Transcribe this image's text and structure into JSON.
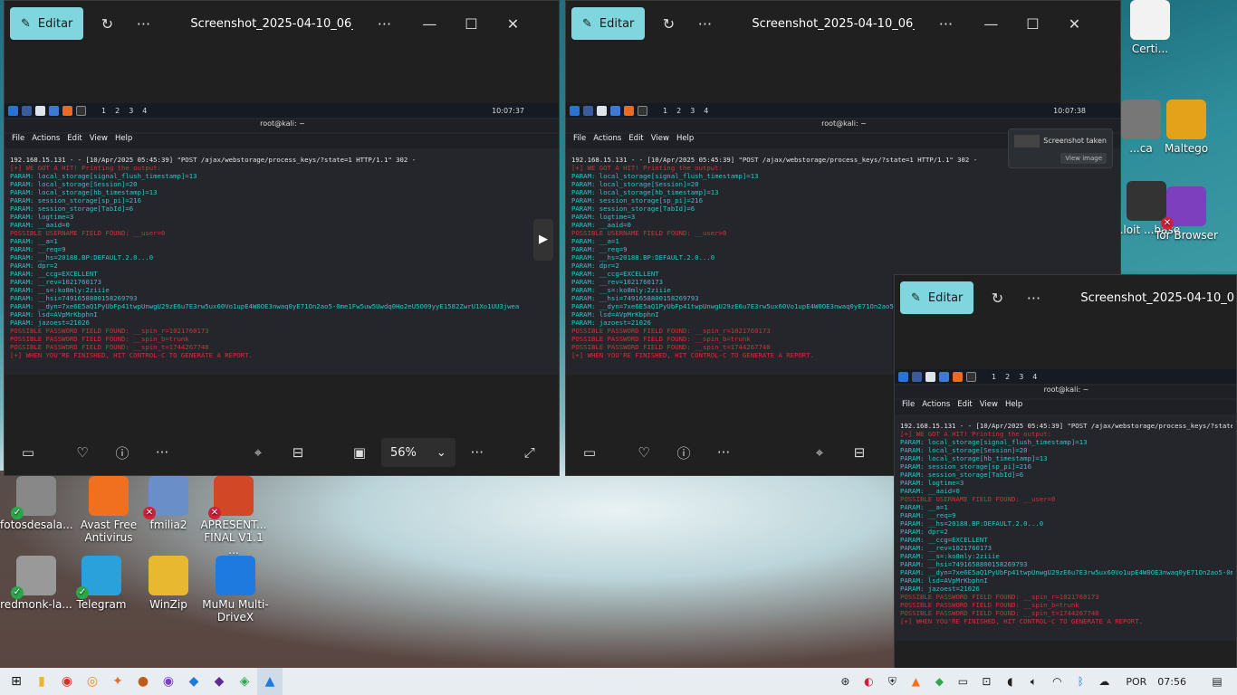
{
  "desktop": {
    "icons": [
      {
        "label": "fotosdesala...",
        "color": "#888",
        "badge": "ok"
      },
      {
        "label": "Avast Free Antivirus",
        "color": "#f07020",
        "badge": ""
      },
      {
        "label": "fmilia2",
        "color": "#6a8ec8",
        "badge": "err"
      },
      {
        "label": "APRESENT... FINAL V1.1 ...",
        "color": "#d24726",
        "badge": "err"
      },
      {
        "label": "redmonk-la...",
        "color": "#999",
        "badge": "ok"
      },
      {
        "label": "Telegram",
        "color": "#2aa1da",
        "badge": "ok"
      },
      {
        "label": "WinZip",
        "color": "#e8b830",
        "badge": ""
      },
      {
        "label": "MuMu Multi-DriveX",
        "color": "#1f7ae0",
        "badge": ""
      },
      {
        "label": "Certi...",
        "color": "#f2f2f2",
        "badge": ""
      },
      {
        "label": "...ca",
        "color": "#777",
        "badge": ""
      },
      {
        "label": "Maltego",
        "color": "#e3a21a",
        "badge": ""
      },
      {
        "label": "...loit ...base",
        "color": "#333",
        "badge": ""
      },
      {
        "label": "Tor Browser",
        "color": "#7e3fbf",
        "badge": "err"
      }
    ]
  },
  "viewer": {
    "edit_label": "Editar",
    "title_left": "Screenshot_2025-04-10_06_07...",
    "title_mid": "Screenshot_2025-04-10_06_07...",
    "title_right": "Screenshot_2025-04-10_06_0",
    "zoom": "56%",
    "screenshot_toast": "Screenshot taken",
    "view_image": "View image"
  },
  "term": {
    "title": "root@kali: ~",
    "menu": [
      "File",
      "Actions",
      "Edit",
      "View",
      "Help"
    ],
    "workspaces": [
      "1",
      "2",
      "3",
      "4"
    ],
    "time_left": "10:07:37",
    "time_mid": "10:07:38",
    "lines": [
      {
        "t": "192.168.15.131 - - [10/Apr/2025 05:45:39] \"POST /ajax/webstorage/process_keys/?state=1 HTTP/1.1\" 302 -",
        "c": "l-w"
      },
      {
        "t": "[+] WE GOT A HIT! Printing the output:",
        "c": "l-r"
      },
      {
        "t": "PARAM: local_storage[signal_flush_timestamp]=13",
        "c": "l-c"
      },
      {
        "t": "PARAM: local_storage[Session]=20",
        "c": "l-c"
      },
      {
        "t": "PARAM: local_storage[hb_timestamp]=13",
        "c": "l-c"
      },
      {
        "t": "PARAM: session_storage[sp_pi]=216",
        "c": "l-c"
      },
      {
        "t": "PARAM: session_storage[TabId]=6",
        "c": "l-c"
      },
      {
        "t": "PARAM: logtime=3",
        "c": "l-c"
      },
      {
        "t": "PARAM: __aaid=0",
        "c": "l-c"
      },
      {
        "t": "POSSIBLE USERNAME FIELD FOUND: __user=0",
        "c": "l-r"
      },
      {
        "t": "PARAM: __a=1",
        "c": "l-c"
      },
      {
        "t": "PARAM: __req=9",
        "c": "l-c"
      },
      {
        "t": "PARAM: __hs=20188.BP:DEFAULT.2.0...0",
        "c": "l-c"
      },
      {
        "t": "PARAM: dpr=2",
        "c": "l-c"
      },
      {
        "t": "PARAM: __ccg=EXCELLENT",
        "c": "l-c"
      },
      {
        "t": "PARAM: __rev=1021760173",
        "c": "l-c"
      },
      {
        "t": "PARAM: __s=:ko8mly:2ziiie",
        "c": "l-c"
      },
      {
        "t": "PARAM: __hsi=7491658800158269793",
        "c": "l-c"
      },
      {
        "t": "PARAM: __dyn=7xe6E5aQ1PyUbFp41twpUnwgU29zE6u7E3rw5ux60Vo1upE4W0OE3nwaq0yE71On2ao5-0me1Fw5uw5Uwdq0Ho2eU5O09yyE1582ZwrU1Xo1UU3jwea",
        "c": "l-c"
      },
      {
        "t": "PARAM: lsd=AVpMrKbphnI",
        "c": "l-c"
      },
      {
        "t": "PARAM: jazoest=21026",
        "c": "l-c"
      },
      {
        "t": "POSSIBLE PASSWORD FIELD FOUND: __spin_r=1021760173",
        "c": "l-r"
      },
      {
        "t": "POSSIBLE PASSWORD FIELD FOUND: __spin_b=trunk",
        "c": "l-r"
      },
      {
        "t": "POSSIBLE PASSWORD FIELD FOUND: __spin_t=1744267740",
        "c": "l-r"
      },
      {
        "t": "[+] WHEN YOU'RE FINISHED, HIT CONTROL-C TO GENERATE A REPORT.",
        "c": "l-r"
      }
    ]
  },
  "taskbar": {
    "lang": "POR",
    "time": "07:56"
  }
}
